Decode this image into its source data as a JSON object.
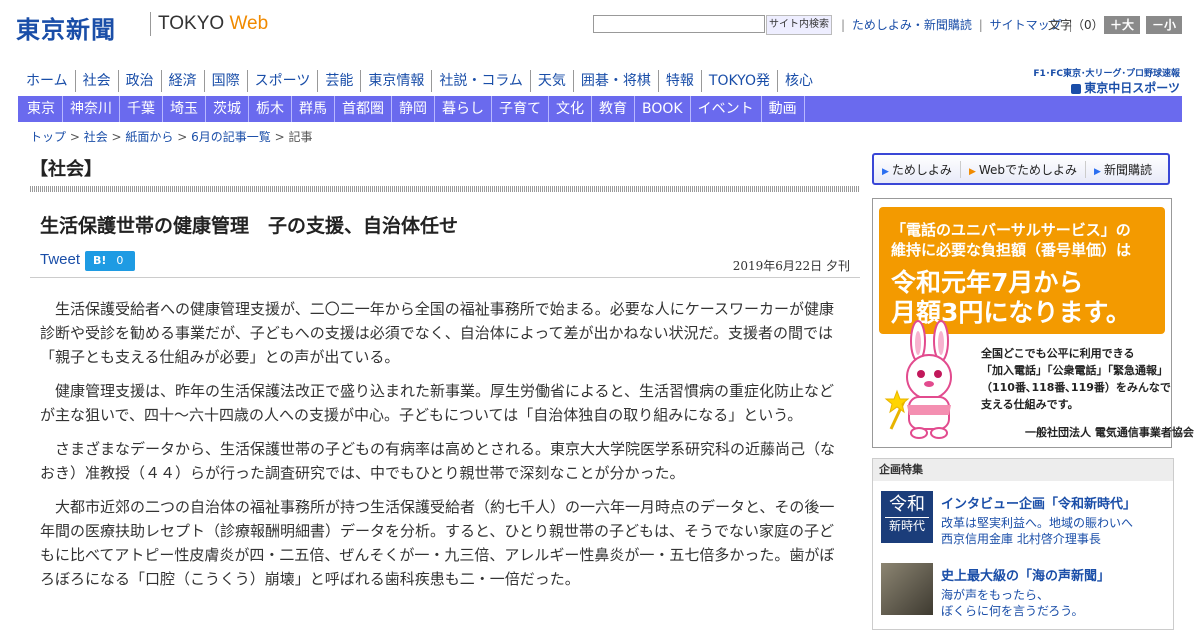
{
  "header": {
    "logo_cn": "東京新聞",
    "logo_tokyo": "TOKYO",
    "logo_web": "Web",
    "search_button": "サイト内検索",
    "links": [
      "ためしよみ・新聞購読",
      "サイトマップ"
    ],
    "font_size_label": "文字（0）",
    "font_larger": "＋大",
    "font_smaller": "－小"
  },
  "nav_primary": [
    "ホーム",
    "社会",
    "政治",
    "経済",
    "国際",
    "スポーツ",
    "芸能",
    "東京情報",
    "社説・コラム",
    "天気",
    "囲碁・将棋",
    "特報",
    "TOKYO発",
    "核心"
  ],
  "chunichi": {
    "small": "F1･FC東京･大リーグ･プロ野球速報",
    "big": "東京中日スポーツ"
  },
  "nav_secondary": [
    "東京",
    "神奈川",
    "千葉",
    "埼玉",
    "茨城",
    "栃木",
    "群馬",
    "首都圏",
    "静岡",
    "暮らし",
    "子育て",
    "文化",
    "教育",
    "BOOK",
    "イベント",
    "動画"
  ],
  "breadcrumb": {
    "items": [
      "トップ",
      "社会",
      "紙面から",
      "6月の記事一覧"
    ],
    "current": "記事",
    "sep": " > "
  },
  "article": {
    "category": "【社会】",
    "title": "生活保護世帯の健康管理　子の支援、自治体任せ",
    "tweet": "Tweet",
    "hatebu_label": "B!",
    "hatebu_count": "0",
    "date": "2019年6月22日 夕刊",
    "paragraphs": [
      "生活保護受給者への健康管理支援が、二〇二一年から全国の福祉事務所で始まる。必要な人にケースワーカーが健康診断や受診を勧める事業だが、子どもへの支援は必須でなく、自治体によって差が出かねない状況だ。支援者の間では「親子とも支える仕組みが必要」との声が出ている。",
      "健康管理支援は、昨年の生活保護法改正で盛り込まれた新事業。厚生労働省によると、生活習慣病の重症化防止などが主な狙いで、四十～六十四歳の人への支援が中心。子どもについては「自治体独自の取り組みになる」という。",
      "さまざまなデータから、生活保護世帯の子どもの有病率は高めとされる。東京大大学院医学系研究科の近藤尚己（なおき）准教授（４４）らが行った調査研究では、中でもひとり親世帯で深刻なことが分かった。",
      "大都市近郊の二つの自治体の福祉事務所が持つ生活保護受給者（約七千人）の一六年一月時点のデータと、その後一年間の医療扶助レセプト（診療報酬明細書）データを分析。すると、ひとり親世帯の子どもは、そうでない家庭の子どもに比べてアトピー性皮膚炎が四・二五倍、ぜんそくが一・九三倍、アレルギー性鼻炎が一・五七倍多かった。歯がぼろぼろになる「口腔（こうくう）崩壊」と呼ばれる歯科疾患も二・一倍だった。"
    ]
  },
  "sidebar": {
    "subscribe": [
      "ためしよみ",
      "Webでためしよみ",
      "新聞購読"
    ],
    "ad": {
      "line1": "「電話のユニバーサルサービス」の",
      "line2": "維持に必要な負担額（番号単価）は",
      "line3": "令和元年7月から",
      "line4": "月額3円になります。",
      "text": [
        "全国どこでも公平に利用できる",
        "「加入電話」「公衆電話」「緊急通報」",
        "（110番､118番､119番）をみんなで",
        "支える仕組みです。"
      ],
      "org": "一般社団法人 電気通信事業者協会",
      "mascot_sash": "UNIVERSAL SERVICE"
    },
    "feature": {
      "heading": "企画特集",
      "items": [
        {
          "thumb_a": "令和",
          "thumb_b": "新時代",
          "title": "インタビュー企画「令和新時代」",
          "sub1": "改革は堅実利益へ。地域の賑わいへ",
          "sub2": "西京信用金庫 北村啓介理事長"
        },
        {
          "title": "史上最大級の「海の声新聞」",
          "sub1": "海が声をもったら、",
          "sub2": "ぼくらに何を言うだろう。"
        }
      ]
    }
  },
  "colors": {
    "brand_blue": "#1a4ea8",
    "nav_bar": "#6a6aee",
    "ad_orange": "#f39a00",
    "hatebu": "#1e9be3"
  }
}
